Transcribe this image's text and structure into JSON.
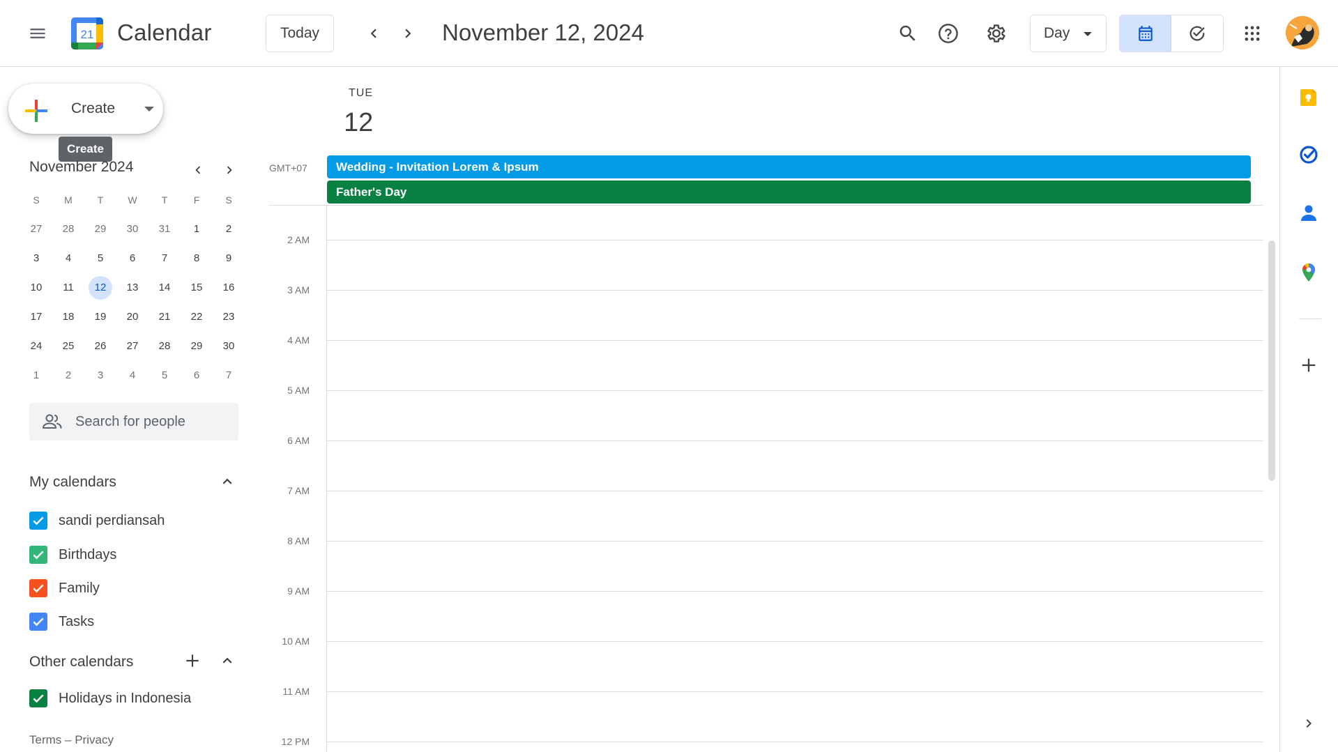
{
  "header": {
    "app_title": "Calendar",
    "logo_day": "21",
    "today_label": "Today",
    "date_title": "November 12, 2024",
    "view_label": "Day"
  },
  "create": {
    "label": "Create",
    "tooltip": "Create"
  },
  "mini_calendar": {
    "title": "November 2024",
    "weekdays": [
      "S",
      "M",
      "T",
      "W",
      "T",
      "F",
      "S"
    ],
    "weeks": [
      [
        "27",
        "28",
        "29",
        "30",
        "31",
        "1",
        "2"
      ],
      [
        "3",
        "4",
        "5",
        "6",
        "7",
        "8",
        "9"
      ],
      [
        "10",
        "11",
        "12",
        "13",
        "14",
        "15",
        "16"
      ],
      [
        "17",
        "18",
        "19",
        "20",
        "21",
        "22",
        "23"
      ],
      [
        "24",
        "25",
        "26",
        "27",
        "28",
        "29",
        "30"
      ],
      [
        "1",
        "2",
        "3",
        "4",
        "5",
        "6",
        "7"
      ]
    ],
    "today": "12"
  },
  "people_search": {
    "placeholder": "Search for people"
  },
  "my_calendars": {
    "title": "My calendars",
    "items": [
      {
        "name": "sandi perdiansah",
        "color": "#039be5",
        "checked": true
      },
      {
        "name": "Birthdays",
        "color": "#33b679",
        "checked": true
      },
      {
        "name": "Family",
        "color": "#f4511e",
        "checked": true
      },
      {
        "name": "Tasks",
        "color": "#4285f4",
        "checked": true
      }
    ]
  },
  "other_calendars": {
    "title": "Other calendars",
    "items": [
      {
        "name": "Holidays in Indonesia",
        "color": "#0b8043",
        "checked": true
      }
    ]
  },
  "footer": {
    "terms": "Terms",
    "separator": "–",
    "privacy": "Privacy"
  },
  "day_view": {
    "dow": "TUE",
    "day": "12",
    "timezone": "GMT+07",
    "all_day_events": [
      {
        "title": "Wedding - Invitation Lorem & Ipsum",
        "color": "#039be5"
      },
      {
        "title": "Father's Day",
        "color": "#0b8043"
      }
    ],
    "hours": [
      "2 AM",
      "3 AM",
      "4 AM",
      "5 AM",
      "6 AM",
      "7 AM",
      "8 AM",
      "9 AM",
      "10 AM",
      "11 AM",
      "12 PM"
    ]
  },
  "icons": {
    "menu": "menu-icon",
    "search": "search-icon",
    "help": "help-icon",
    "settings": "gear-icon",
    "apps": "apps-grid-icon",
    "keep": "keep-icon",
    "tasks": "tasks-icon",
    "contacts": "contacts-icon",
    "maps": "maps-icon",
    "add": "plus-icon",
    "expand": "chevron-right-icon"
  }
}
